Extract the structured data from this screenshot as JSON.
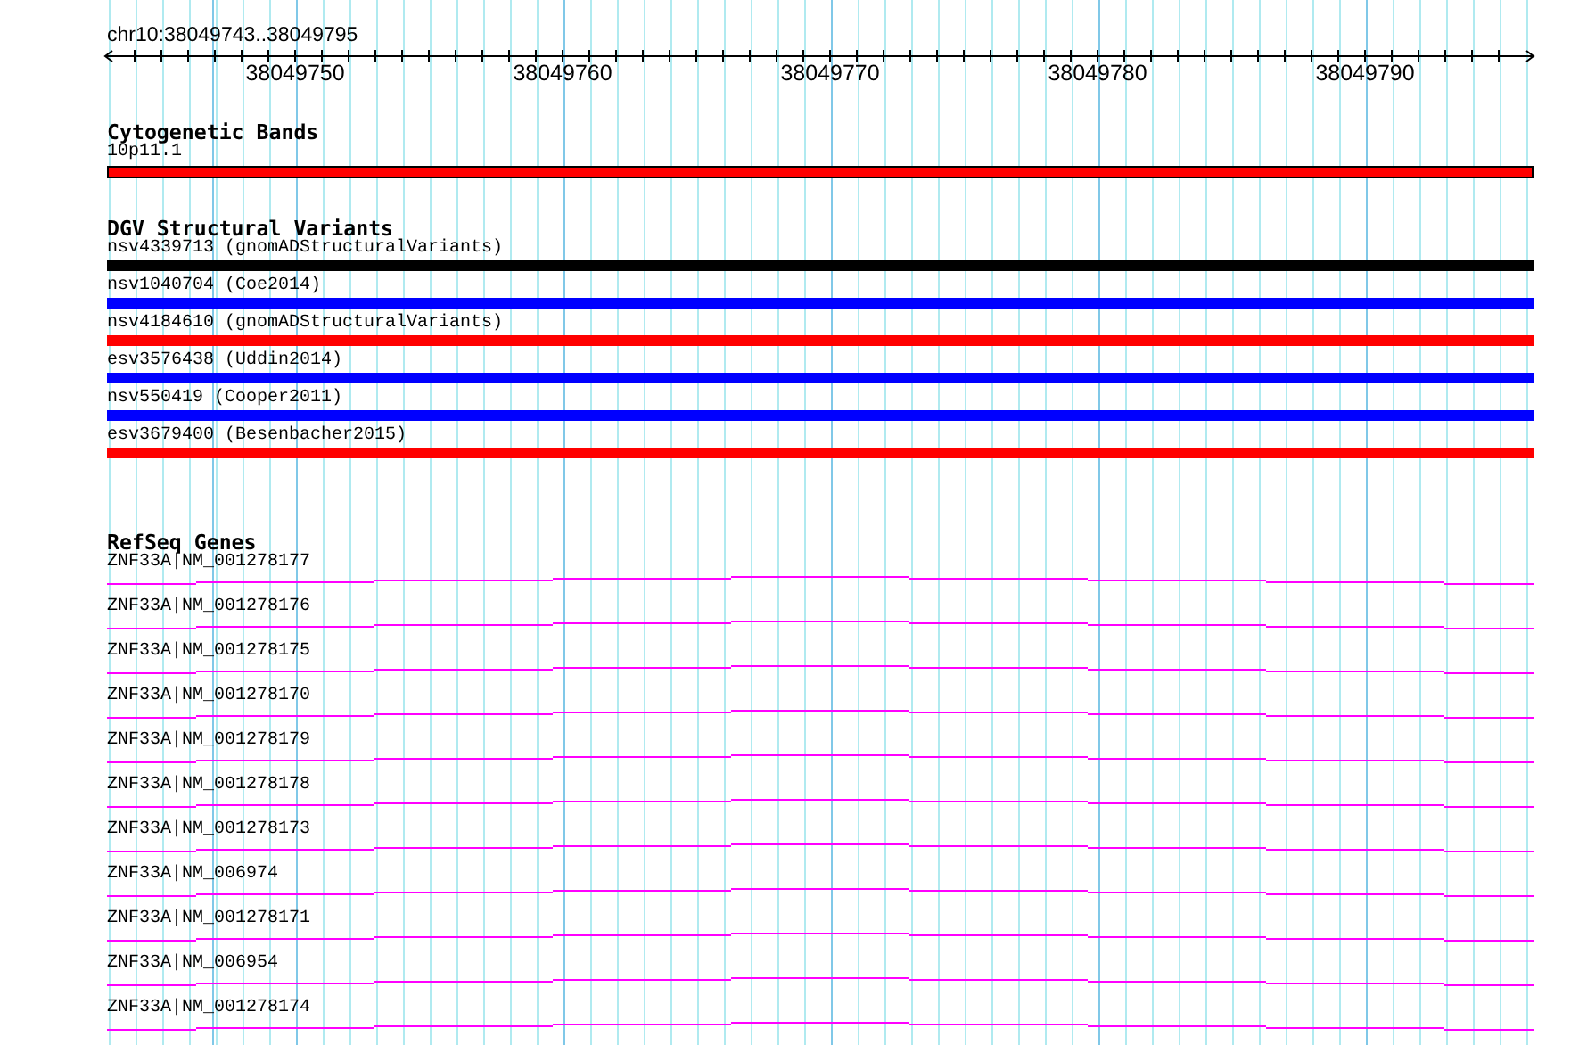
{
  "ruler": {
    "location": "chr10:38049743..38049795",
    "ticks": [
      "38049750",
      "38049760",
      "38049770",
      "38049780",
      "38049790"
    ]
  },
  "tracks": [
    {
      "title": "Cytogenetic Bands",
      "kind": "band",
      "features": [
        {
          "label": "10p11.1",
          "color": "#ff0000"
        }
      ]
    },
    {
      "title": "DGV Structural Variants",
      "kind": "variant",
      "features": [
        {
          "label": "nsv4339713 (gnomADStructuralVariants)",
          "color": "#000000"
        },
        {
          "label": "nsv1040704 (Coe2014)",
          "color": "#0000ff"
        },
        {
          "label": "nsv4184610 (gnomADStructuralVariants)",
          "color": "#ff0000"
        },
        {
          "label": "esv3576438 (Uddin2014)",
          "color": "#0000ff"
        },
        {
          "label": "nsv550419 (Cooper2011)",
          "color": "#0000ff"
        },
        {
          "label": "esv3679400 (Besenbacher2015)",
          "color": "#ff0000"
        }
      ]
    },
    {
      "title": "RefSeq Genes",
      "kind": "gene",
      "features": [
        {
          "label": "ZNF33A|NM_001278177"
        },
        {
          "label": "ZNF33A|NM_001278176"
        },
        {
          "label": "ZNF33A|NM_001278175"
        },
        {
          "label": "ZNF33A|NM_001278170"
        },
        {
          "label": "ZNF33A|NM_001278179"
        },
        {
          "label": "ZNF33A|NM_001278178"
        },
        {
          "label": "ZNF33A|NM_001278173"
        },
        {
          "label": "ZNF33A|NM_006974"
        },
        {
          "label": "ZNF33A|NM_001278171"
        },
        {
          "label": "ZNF33A|NM_006954"
        },
        {
          "label": "ZNF33A|NM_001278174"
        }
      ]
    }
  ]
}
